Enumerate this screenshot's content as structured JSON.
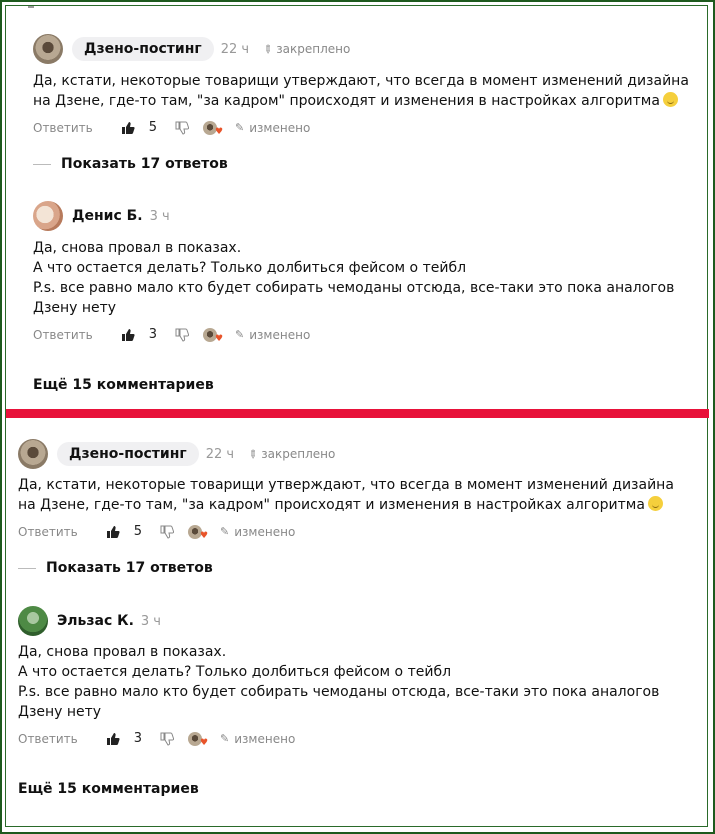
{
  "top": {
    "comment": {
      "author": "Дзено-постинг",
      "time": "22 ч",
      "pinned": "закреплено",
      "line1": "Да, кстати, некоторые товарищи утверждают, что всегда в момент изменений дизайна",
      "line2": "на Дзене, где-то там, \"за кадром\" происходят и изменения в настройках алгоритма",
      "reply": "Ответить",
      "likes": "5",
      "edited": "изменено"
    },
    "show_replies": "Показать 17 ответов",
    "reply": {
      "author": "Денис Б.",
      "time": "3 ч",
      "line1": "Да, снова провал в показах.",
      "line2": "А что остается делать? Только долбиться фейсом о тейбл",
      "line3": "P.s. все равно мало кто будет собирать чемоданы отсюда, все-таки это пока аналогов",
      "line4": "Дзену нету",
      "reply": "Ответить",
      "likes": "3",
      "edited": "изменено"
    },
    "more": "Ещё 15 комментариев"
  },
  "bottom": {
    "comment": {
      "author": "Дзено-постинг",
      "time": "22 ч",
      "pinned": "закреплено",
      "line1": "Да, кстати, некоторые товарищи утверждают, что всегда в момент изменений дизайна",
      "line2": "на Дзене, где-то там, \"за кадром\" происходят и изменения в настройках алгоритма",
      "reply": "Ответить",
      "likes": "5",
      "edited": "изменено"
    },
    "show_replies": "Показать 17 ответов",
    "reply": {
      "author": "Эльзас К.",
      "time": "3 ч",
      "line1": "Да, снова провал в показах.",
      "line2": "А что остается делать? Только долбиться фейсом о тейбл",
      "line3": "P.s. все равно мало кто будет собирать чемоданы отсюда, все-таки это пока аналогов",
      "line4": "Дзену нету",
      "reply": "Ответить",
      "likes": "3",
      "edited": "изменено"
    },
    "more": "Ещё 15 комментариев"
  },
  "colors": {
    "divider": "#e8123a",
    "frame": "#1e5a1e"
  }
}
